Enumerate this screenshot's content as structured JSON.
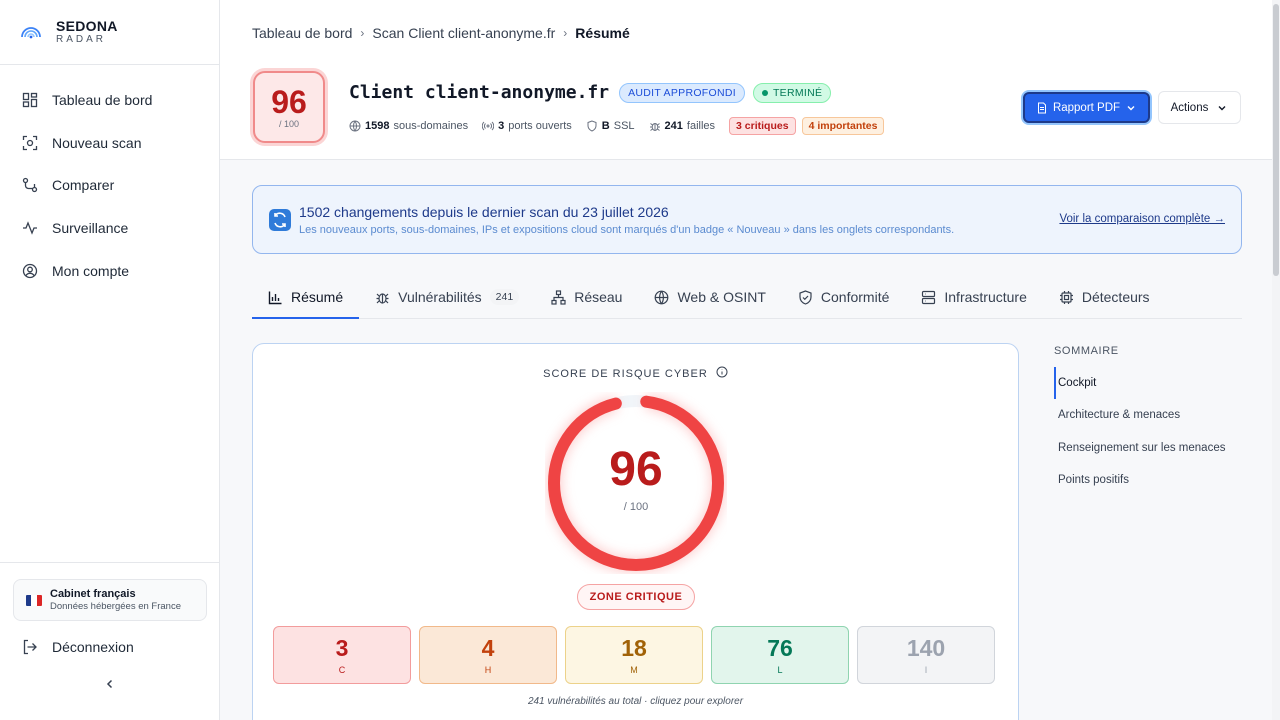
{
  "brand": {
    "name": "SEDONA",
    "sub": "RADAR"
  },
  "sidebar": {
    "items": [
      {
        "label": "Tableau de bord",
        "icon": "dashboard-icon"
      },
      {
        "label": "Nouveau scan",
        "icon": "scan-icon"
      },
      {
        "label": "Comparer",
        "icon": "compare-icon"
      },
      {
        "label": "Surveillance",
        "icon": "activity-icon"
      },
      {
        "label": "Mon compte",
        "icon": "user-circle-icon"
      }
    ],
    "cabinet": {
      "title": "Cabinet français",
      "subtitle": "Données hébergées en France"
    },
    "logout_label": "Déconnexion"
  },
  "breadcrumb": [
    "Tableau de bord",
    "Scan Client client-anonyme.fr",
    "Résumé"
  ],
  "header": {
    "score": "96",
    "score_max": "/ 100",
    "title": "Client client-anonyme.fr",
    "badge_audit": "AUDIT APPROFONDI",
    "badge_status": "TERMINÉ",
    "stats": {
      "subdomains_value": "1598",
      "subdomains_label": "sous-domaines",
      "ports_value": "3",
      "ports_label": "ports ouverts",
      "ssl_value": "B",
      "ssl_label": "SSL",
      "flaws_value": "241",
      "flaws_label": "failles"
    },
    "tag_critical": "3 critiques",
    "tag_important": "4 importantes",
    "pdf_label": "Rapport PDF",
    "actions_label": "Actions"
  },
  "banner": {
    "heading": "1502 changements depuis le dernier scan du 23 juillet 2026",
    "subtext": "Les nouveaux ports, sous-domaines, IPs et expositions cloud sont marqués d'un badge « Nouveau » dans les onglets correspondants.",
    "link": "Voir la comparaison complète →"
  },
  "tabs": [
    {
      "label": "Résumé",
      "active": true
    },
    {
      "label": "Vulnérabilités",
      "count": "241"
    },
    {
      "label": "Réseau"
    },
    {
      "label": "Web & OSINT"
    },
    {
      "label": "Conformité"
    },
    {
      "label": "Infrastructure"
    },
    {
      "label": "Détecteurs"
    }
  ],
  "risk": {
    "title": "SCORE DE RISQUE CYBER",
    "score": 96,
    "score_display": "96",
    "max_display": "/ 100",
    "zone": "ZONE CRITIQUE",
    "severities": [
      {
        "count": "3",
        "letter": "C"
      },
      {
        "count": "4",
        "letter": "H"
      },
      {
        "count": "18",
        "letter": "M"
      },
      {
        "count": "76",
        "letter": "L"
      },
      {
        "count": "140",
        "letter": "I"
      }
    ],
    "footer": "241 vulnérabilités au total · cliquez pour explorer"
  },
  "summary": {
    "heading": "SOMMAIRE",
    "items": [
      "Cockpit",
      "Architecture & menaces",
      "Renseignement sur les menaces",
      "Points positifs"
    ]
  },
  "colors": {
    "accent": "#2563eb",
    "critical": "#ef4444",
    "critical_text": "#b91c1c"
  }
}
